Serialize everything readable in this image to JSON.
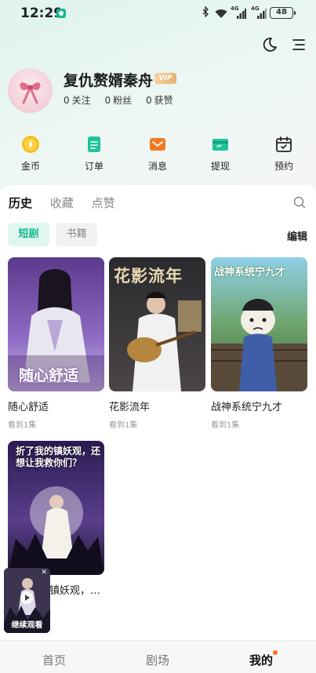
{
  "status_bar": {
    "time": "12:29",
    "network1": "4G",
    "network2": "4G",
    "battery": "48"
  },
  "profile": {
    "username": "复仇赘婿秦舟",
    "vip_label": "VIP",
    "stats": [
      {
        "value": "0",
        "label": "关注"
      },
      {
        "value": "0",
        "label": "粉丝"
      },
      {
        "value": "0",
        "label": "获赞"
      }
    ]
  },
  "quick_actions": [
    {
      "label": "金币",
      "icon": "coin-icon"
    },
    {
      "label": "订单",
      "icon": "order-icon"
    },
    {
      "label": "消息",
      "icon": "message-icon"
    },
    {
      "label": "提现",
      "icon": "withdraw-icon"
    },
    {
      "label": "预约",
      "icon": "calendar-icon"
    }
  ],
  "history": {
    "tabs": [
      "历史",
      "收藏",
      "点赞"
    ],
    "chips": [
      "短剧",
      "书籍"
    ],
    "edit_label": "编辑",
    "items": [
      {
        "title": "随心舒适",
        "progress": "看到1集",
        "poster_text": "随心舒适"
      },
      {
        "title": "花影流年",
        "progress": "看到1集",
        "poster_text": "花影流年"
      },
      {
        "title": "战神系统宁九才",
        "progress": "看到1集",
        "poster_text": "战神系统宁九才"
      },
      {
        "title": "镇妖观，…",
        "progress": "",
        "poster_text": "折了我的镇妖观，还想让我救你们？"
      }
    ]
  },
  "float_player": {
    "label": "继续观看"
  },
  "bottom_nav": [
    "首页",
    "剧场",
    "我的"
  ],
  "colors": {
    "accent": "#16b88d",
    "vip": "#e8b070",
    "nav_dot": "#ff6a1f"
  }
}
